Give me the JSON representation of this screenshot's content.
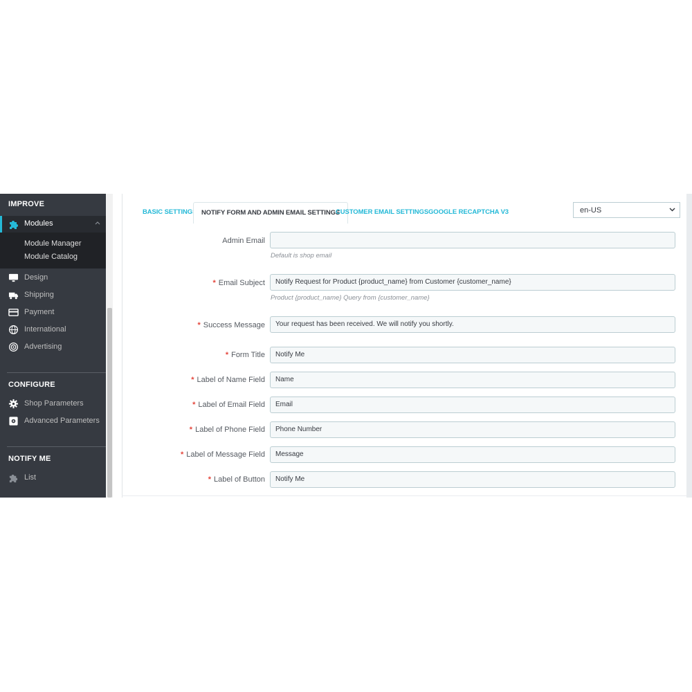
{
  "sidebar": {
    "improve_title": "IMPROVE",
    "modules_label": "Modules",
    "submenu": [
      "Module Manager",
      "Module Catalog"
    ],
    "improve_items": [
      {
        "label": "Design",
        "icon": "monitor-icon"
      },
      {
        "label": "Shipping",
        "icon": "truck-icon"
      },
      {
        "label": "Payment",
        "icon": "credit-card-icon"
      },
      {
        "label": "International",
        "icon": "globe-icon"
      },
      {
        "label": "Advertising",
        "icon": "target-icon"
      }
    ],
    "configure_title": "CONFIGURE",
    "configure_items": [
      {
        "label": "Shop Parameters",
        "icon": "gear-icon"
      },
      {
        "label": "Advanced Parameters",
        "icon": "settings-box-icon"
      }
    ],
    "notify_title": "NOTIFY ME",
    "notify_items": [
      {
        "label": "List",
        "icon": "puzzle-icon"
      }
    ],
    "accent_color": "#25b9d7"
  },
  "tabs": [
    {
      "label": "BASIC SETTINGS",
      "active": false
    },
    {
      "label": "NOTIFY FORM AND ADMIN EMAIL SETTINGS",
      "active": true
    },
    {
      "label": "CUSTOMER EMAIL SETTINGS",
      "active": false
    },
    {
      "label": "GOOGLE RECAPTCHA V3",
      "active": false
    }
  ],
  "language": {
    "selected": "en-US"
  },
  "form": {
    "admin_email": {
      "label": "Admin Email",
      "value": "",
      "help": "Default is shop email"
    },
    "email_subject": {
      "label": "Email Subject",
      "value": "Notify Request for Product {product_name} from Customer {customer_name}",
      "help": "Product {product_name} Query from {customer_name}"
    },
    "success_message": {
      "label": "Success Message",
      "value": "Your request has been received. We will notify you shortly."
    },
    "form_title": {
      "label": "Form Title",
      "value": "Notify Me"
    },
    "name_field": {
      "label": "Label of Name Field",
      "value": "Name"
    },
    "email_field": {
      "label": "Label of Email Field",
      "value": "Email"
    },
    "phone_field": {
      "label": "Label of Phone Field",
      "value": "Phone Number"
    },
    "message_field": {
      "label": "Label of Message Field",
      "value": "Message"
    },
    "button_label": {
      "label": "Label of Button",
      "value": "Notify Me"
    },
    "required_mark": "*"
  }
}
